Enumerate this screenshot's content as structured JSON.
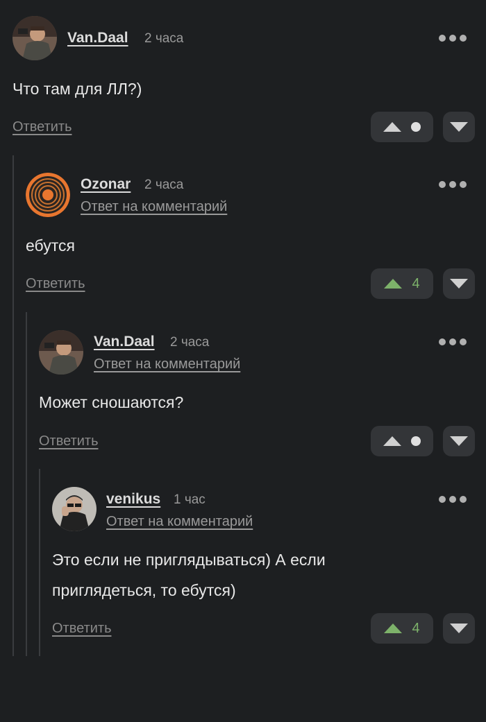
{
  "colors": {
    "background": "#1d1f21",
    "button_bg": "#333538",
    "positive": "#7db26a"
  },
  "reply_link": "Ответить",
  "reply_to_label": "Ответ на комментарий",
  "comments": [
    {
      "user": "Van.Daal",
      "time": "2 часа",
      "text": "Что там для ЛЛ?)",
      "score": "",
      "avatar": "avatar-photo-man-icon"
    },
    {
      "user": "Ozonar",
      "time": "2 часа",
      "text": "ебутся",
      "score": "4",
      "avatar": "avatar-orange-target-icon"
    },
    {
      "user": "Van.Daal",
      "time": "2 часа",
      "text": "Может сношаются?",
      "score": "",
      "avatar": "avatar-photo-man-icon"
    },
    {
      "user": "venikus",
      "time": "1 час",
      "text_line1": "Это если не приглядываться) А если",
      "text_line2": "приглядеться, то ебутся)",
      "score": "4",
      "avatar": "avatar-photo-man-icon"
    }
  ]
}
